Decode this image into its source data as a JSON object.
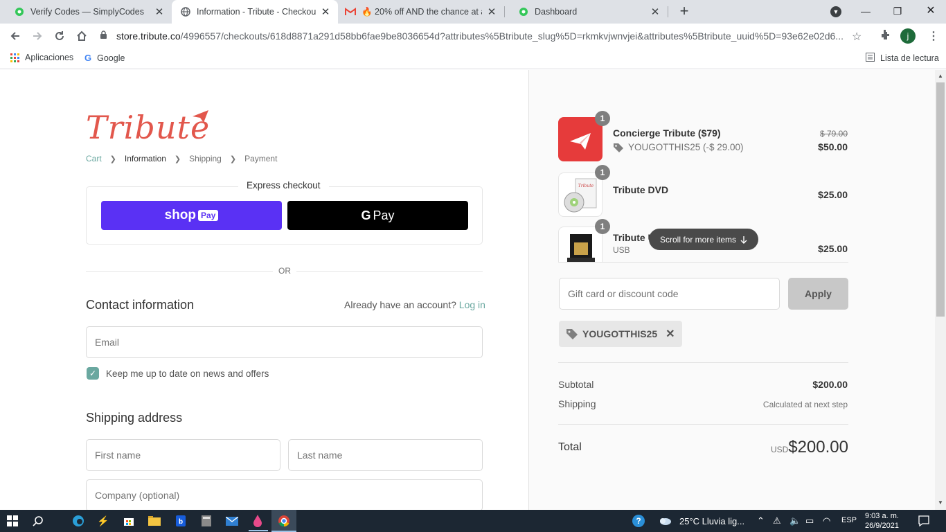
{
  "browser": {
    "tabs": [
      {
        "title": "Verify Codes — SimplyCodes",
        "icon": "simplycodes-icon",
        "color": "#34c759"
      },
      {
        "title": "Information - Tribute - Checkout",
        "icon": "globe-icon",
        "active": true
      },
      {
        "title": "🔥 20% off AND the chance at a",
        "icon": "gmail-icon"
      },
      {
        "title": "Dashboard",
        "icon": "dashboard-icon",
        "color": "#34c759"
      }
    ],
    "url_host": "store.tribute.co",
    "url_path": "/4996557/checkouts/618d8871a291d58bb6fae9be8036654d?attributes%5Btribute_slug%5D=rkmkvjwnvjei&attributes%5Btribute_uuid%5D=93e62e02d6...",
    "profile_initial": "j",
    "bookmarks": [
      "Aplicaciones",
      "Google"
    ],
    "reading_list": "Lista de lectura"
  },
  "checkout": {
    "logo": "Tribute",
    "breadcrumbs": [
      "Cart",
      "Information",
      "Shipping",
      "Payment"
    ],
    "express_title": "Express checkout",
    "shoppay_label": "shop",
    "shoppay_badge": "Pay",
    "gpay_g": "G",
    "gpay_label": "Pay",
    "or_label": "OR",
    "contact_title": "Contact information",
    "account_prompt": "Already have an account?",
    "login_link": "Log in",
    "email_placeholder": "Email",
    "newsletter_label": "Keep me up to date on news and offers",
    "shipping_title": "Shipping address",
    "first_name_placeholder": "First name",
    "last_name_placeholder": "Last name",
    "company_placeholder": "Company (optional)"
  },
  "summary": {
    "items": [
      {
        "qty": "1",
        "name": "Concierge Tribute ($79)",
        "discount": "YOUGOTTHIS25 (-$ 29.00)",
        "old_price": "$ 79.00",
        "price": "$50.00"
      },
      {
        "qty": "1",
        "name": "Tribute DVD",
        "price": "$25.00"
      },
      {
        "qty": "1",
        "name": "Tribute US",
        "sub": "USB",
        "price": "$25.00"
      }
    ],
    "scroll_hint": "Scroll for more items",
    "discount_placeholder": "Gift card or discount code",
    "apply_label": "Apply",
    "applied_code": "YOUGOTTHIS25",
    "subtotal_label": "Subtotal",
    "subtotal_value": "$200.00",
    "shipping_label": "Shipping",
    "shipping_value": "Calculated at next step",
    "total_label": "Total",
    "total_currency": "USD",
    "total_value": "$200.00"
  },
  "taskbar": {
    "weather": "25°C  Lluvia lig...",
    "language": "ESP",
    "time": "9:03 a. m.",
    "date": "26/9/2021"
  },
  "colors": {
    "accent": "#6aa8a0",
    "brand": "#e2574c",
    "shoppay": "#5a31f4"
  }
}
